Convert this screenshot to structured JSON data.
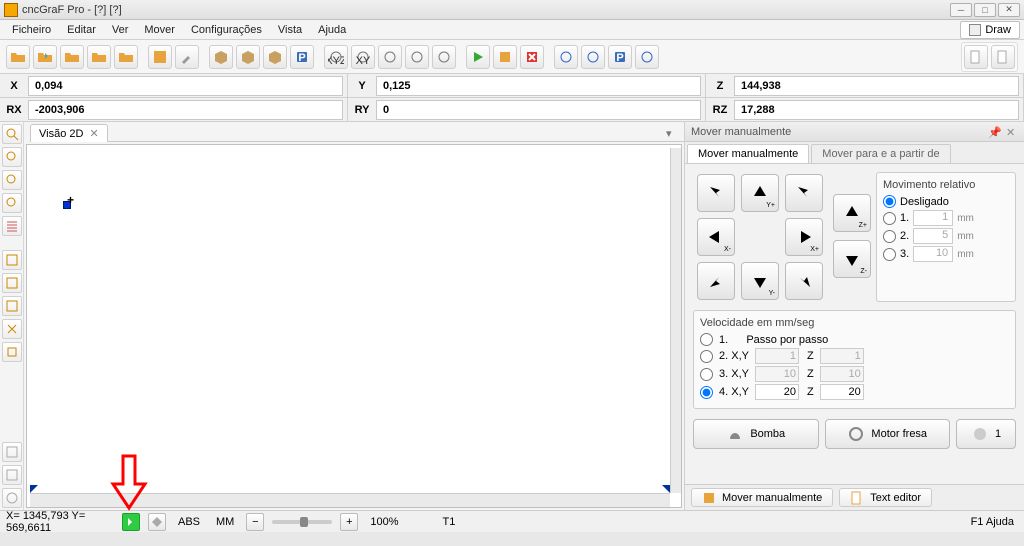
{
  "title": "cncGraF Pro - [?]  [?]",
  "menu": {
    "ficheiro": "Ficheiro",
    "editar": "Editar",
    "ver": "Ver",
    "mover": "Mover",
    "configuracoes": "Configurações",
    "vista": "Vista",
    "ajuda": "Ajuda",
    "draw": "Draw"
  },
  "coords": {
    "x_lbl": "X",
    "x_val": "0,094",
    "y_lbl": "Y",
    "y_val": "0,125",
    "z_lbl": "Z",
    "z_val": "144,938",
    "rx_lbl": "RX",
    "rx_val": "-2003,906",
    "ry_lbl": "RY",
    "ry_val": "0",
    "rz_lbl": "RZ",
    "rz_val": "17,288"
  },
  "tab": {
    "name": "Visão 2D"
  },
  "panel": {
    "title": "Mover manualmente",
    "tab1": "Mover manualmente",
    "tab2": "Mover para e a partir de",
    "rel_hdr": "Movimento relativo",
    "rel_off": "Desligado",
    "rel_1": "1.",
    "rel_1_v": "1",
    "rel_1_u": "mm",
    "rel_2": "2.",
    "rel_2_v": "5",
    "rel_2_u": "mm",
    "rel_3": "3.",
    "rel_3_v": "10",
    "rel_3_u": "mm",
    "vel_hdr": "Velocidade em mm/seg",
    "v1": "1.",
    "v1_lbl": "Passo por passo",
    "v2": "2. X,Y",
    "v2_xy": "1",
    "v2_z": "1",
    "v3": "3. X,Y",
    "v3_xy": "10",
    "v3_z": "10",
    "v4": "4. X,Y",
    "v4_xy": "20",
    "v4_z": "20",
    "z_lbl": "Z",
    "bomba": "Bomba",
    "motor": "Motor fresa",
    "num1": "1",
    "btab1": "Mover manualmente",
    "btab2": "Text editor"
  },
  "status": {
    "coord": "X= 1345,793 Y= 569,6611",
    "abs": "ABS",
    "mm": "MM",
    "zoom": "100%",
    "t1": "T1",
    "help": "F1 Ajuda"
  }
}
